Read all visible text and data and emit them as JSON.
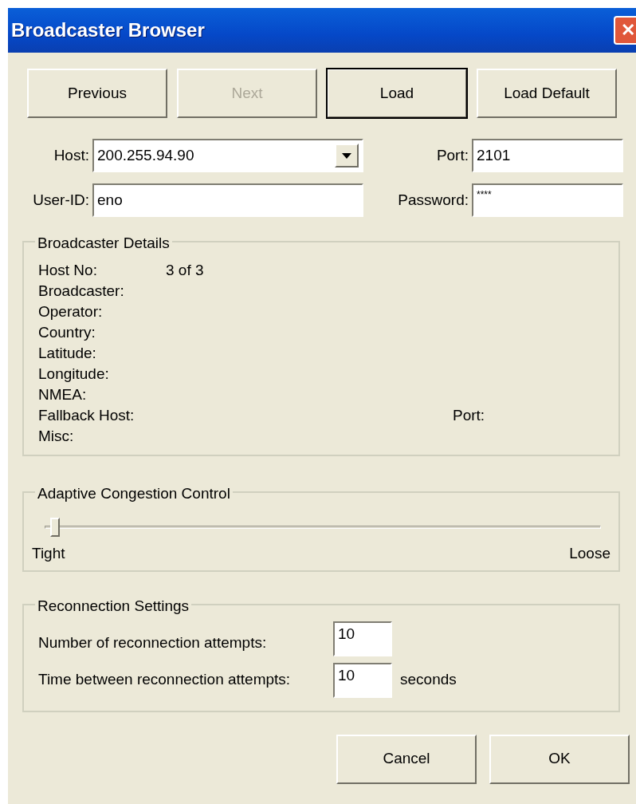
{
  "window": {
    "title": "Broadcaster Browser",
    "close": "✕"
  },
  "top_buttons": [
    {
      "label": "Previous",
      "disabled": false,
      "default": false
    },
    {
      "label": "Next",
      "disabled": true,
      "default": false
    },
    {
      "label": "Load",
      "disabled": false,
      "default": true
    },
    {
      "label": "Load Default",
      "disabled": false,
      "default": false
    }
  ],
  "host": {
    "label": "Host:",
    "value": "200.255.94.90"
  },
  "port": {
    "label": "Port:",
    "value": "2101"
  },
  "user_id": {
    "label": "User-ID:",
    "value": "eno"
  },
  "password": {
    "label": "Password:",
    "value": "****"
  },
  "details": {
    "title": "Broadcaster Details",
    "rows": [
      {
        "label": "Host No:",
        "value": "3 of 3"
      },
      {
        "label": "Broadcaster:"
      },
      {
        "label": "Operator:"
      },
      {
        "label": "Country:"
      },
      {
        "label": "Latitude:"
      },
      {
        "label": "Longitude:"
      },
      {
        "label": "NMEA:"
      },
      {
        "label": "Fallback Host:",
        "extra_label": "Port:"
      },
      {
        "label": "Misc:"
      }
    ]
  },
  "congestion": {
    "title": "Adaptive Congestion Control",
    "level": 0.01,
    "min_label": "Tight",
    "max_label": "Loose"
  },
  "reconnection": {
    "title": "Reconnection Settings",
    "rows": [
      {
        "label": "Number of reconnection attempts:",
        "value": "10"
      },
      {
        "label": "Time between reconnection attempts:",
        "value": "10",
        "unit": "seconds"
      }
    ]
  },
  "bottom_buttons": [
    {
      "label": "Cancel",
      "disabled": false,
      "default": false
    },
    {
      "label": "OK",
      "disabled": false,
      "default": false
    }
  ]
}
